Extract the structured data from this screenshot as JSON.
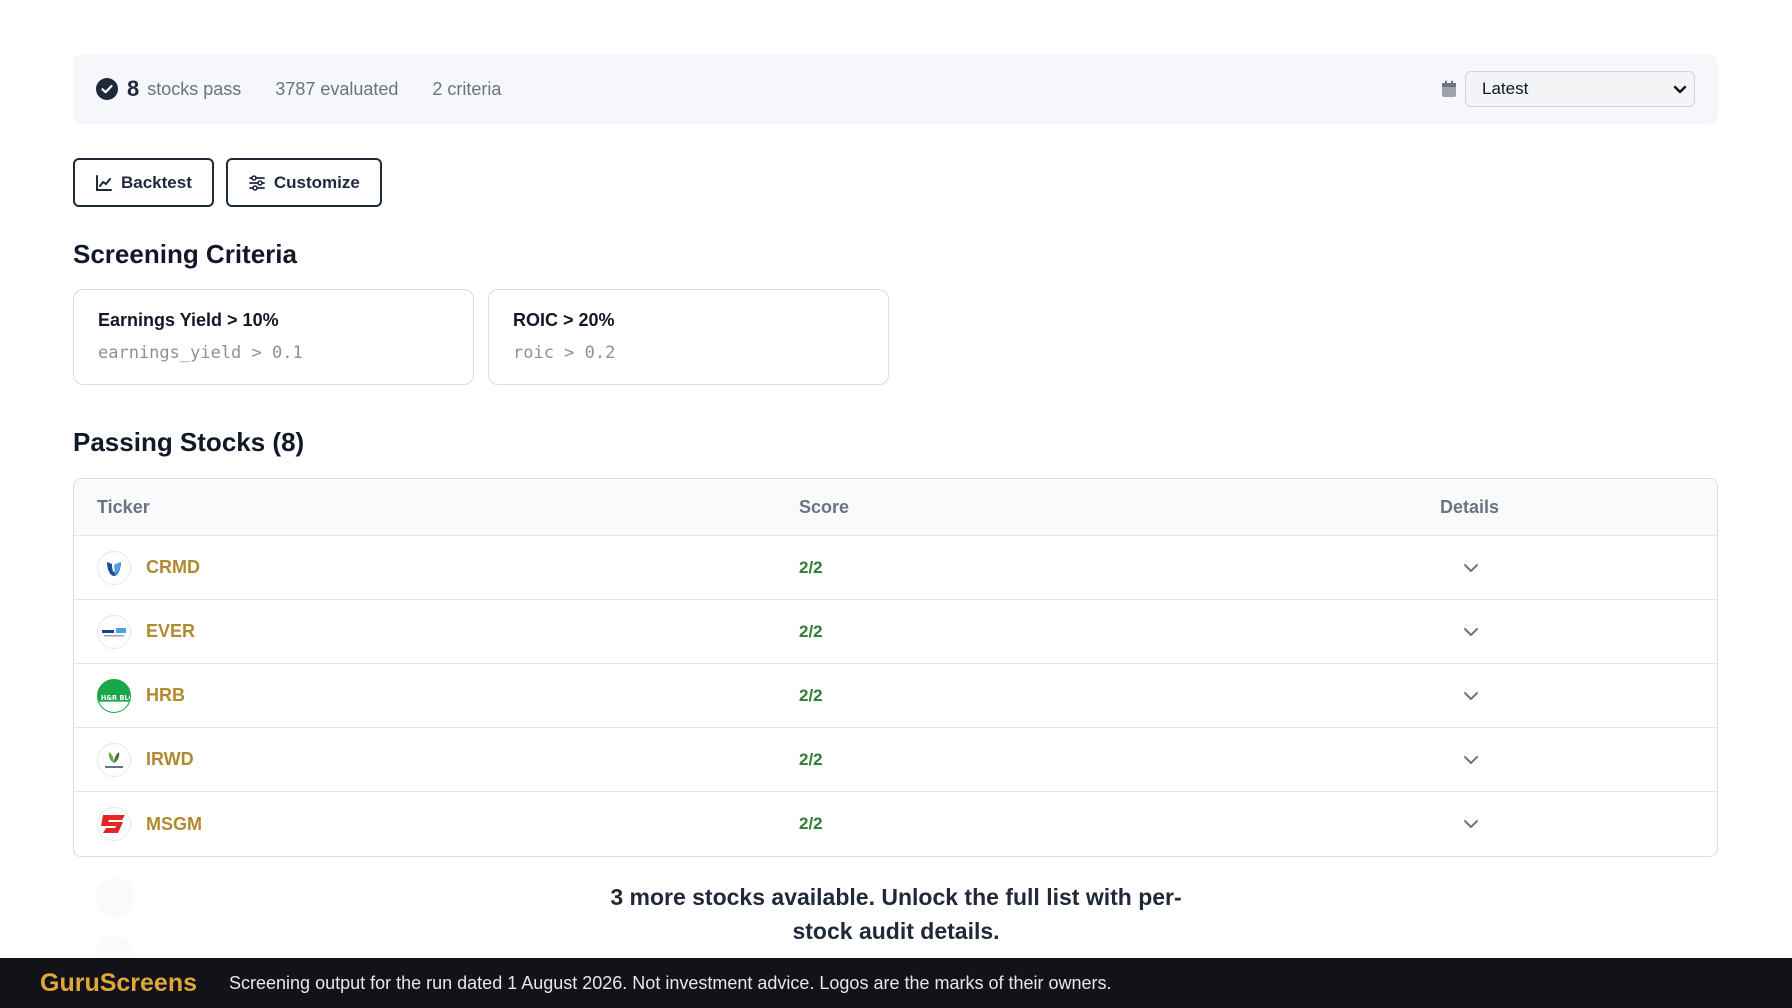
{
  "summary": {
    "pass_count": "8",
    "pass_label": "stocks pass",
    "evaluated": "3787 evaluated",
    "criteria_count": "2 criteria",
    "date_value": "Latest"
  },
  "actions": {
    "backtest_label": "Backtest",
    "customize_label": "Customize"
  },
  "criteria_section": {
    "title": "Screening Criteria",
    "items": [
      {
        "name": "Earnings Yield > 10%",
        "expr": "earnings_yield > 0.1"
      },
      {
        "name": "ROIC > 20%",
        "expr": "roic > 0.2"
      }
    ]
  },
  "passing_section": {
    "title": "Passing Stocks (8)",
    "columns": {
      "ticker": "Ticker",
      "score": "Score",
      "details": "Details"
    },
    "rows": [
      {
        "ticker": "CRMD",
        "score": "2/2",
        "logo": "crmd-logo"
      },
      {
        "ticker": "EVER",
        "score": "2/2",
        "logo": "ever-logo"
      },
      {
        "ticker": "HRB",
        "score": "2/2",
        "logo": "hrb-logo",
        "logo_text": "H&R BLOCK"
      },
      {
        "ticker": "IRWD",
        "score": "2/2",
        "logo": "irwd-logo"
      },
      {
        "ticker": "MSGM",
        "score": "2/2",
        "logo": "msgm-logo"
      }
    ],
    "more_text": "3 more stocks available. Unlock the full list with per-stock audit details."
  },
  "footer": {
    "brand": "GuruScreens",
    "note": "Screening output for the run dated 1 August 2026. Not investment advice. Logos are the marks of their owners."
  },
  "colors": {
    "ticker": "#b08a2e",
    "score": "#2e7d32",
    "brand": "#e0a63a",
    "navy": "#1e293b"
  }
}
